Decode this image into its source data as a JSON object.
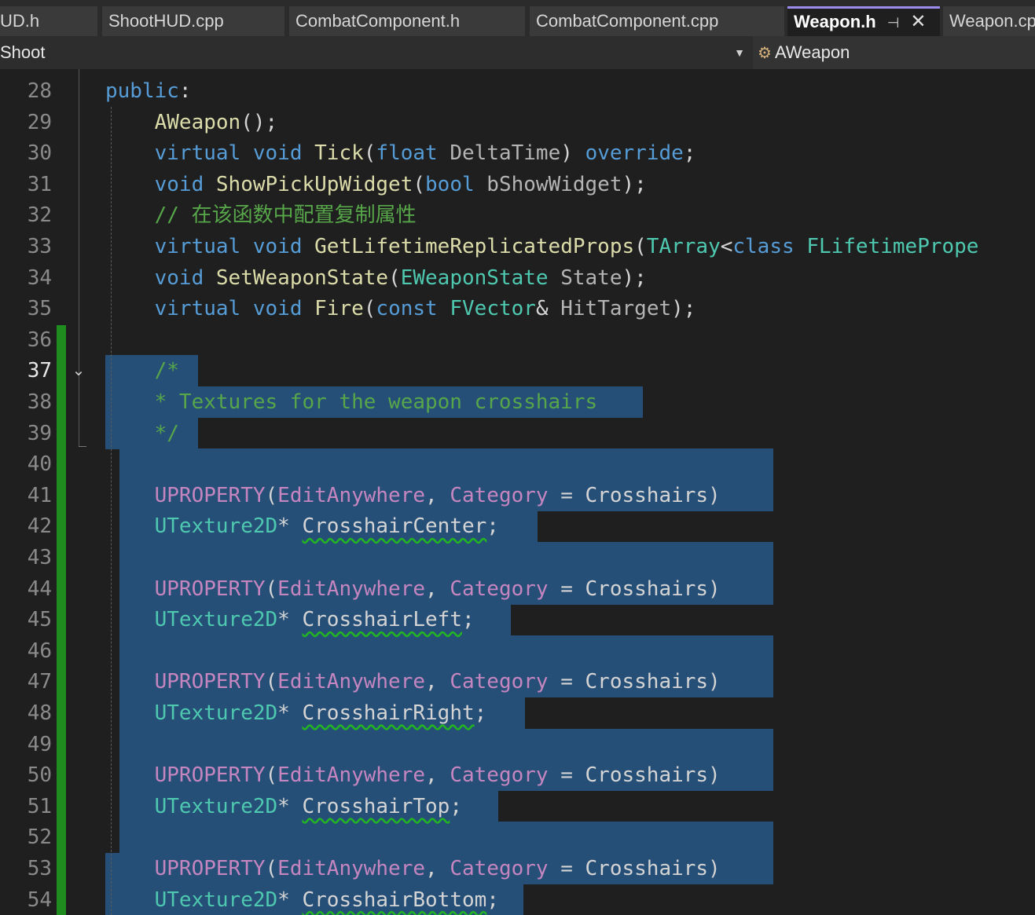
{
  "tabs": [
    {
      "label": "UD.h",
      "active": false
    },
    {
      "label": "ShootHUD.cpp",
      "active": false
    },
    {
      "label": "CombatComponent.h",
      "active": false
    },
    {
      "label": "CombatComponent.cpp",
      "active": false
    },
    {
      "label": "Weapon.h",
      "active": true
    },
    {
      "label": "Weapon.cp",
      "active": false
    }
  ],
  "tab_icons": {
    "pin": "pin-icon",
    "close": "close-icon"
  },
  "navbar": {
    "project": "Shoot",
    "class_scope": "AWeapon",
    "class_icon": "class-icon"
  },
  "editor": {
    "current_line": "37",
    "line_numbers": [
      "28",
      "29",
      "30",
      "31",
      "32",
      "33",
      "34",
      "35",
      "36",
      "37",
      "38",
      "39",
      "40",
      "41",
      "42",
      "43",
      "44",
      "45",
      "46",
      "47",
      "48",
      "49",
      "50",
      "51",
      "52",
      "53",
      "54"
    ],
    "lines": [
      [
        {
          "t": "public",
          "c": "kw"
        },
        {
          "t": ":",
          "c": "pl"
        }
      ],
      [
        {
          "t": "    ",
          "c": "pl"
        },
        {
          "t": "AWeapon",
          "c": "fn"
        },
        {
          "t": "();",
          "c": "pl"
        }
      ],
      [
        {
          "t": "    ",
          "c": "pl"
        },
        {
          "t": "virtual",
          "c": "kw"
        },
        {
          "t": " ",
          "c": "pl"
        },
        {
          "t": "void",
          "c": "kw"
        },
        {
          "t": " ",
          "c": "pl"
        },
        {
          "t": "Tick",
          "c": "fn"
        },
        {
          "t": "(",
          "c": "pl"
        },
        {
          "t": "float",
          "c": "kw"
        },
        {
          "t": " ",
          "c": "pl"
        },
        {
          "t": "DeltaTime",
          "c": "pa"
        },
        {
          "t": ") ",
          "c": "pl"
        },
        {
          "t": "override",
          "c": "kw"
        },
        {
          "t": ";",
          "c": "pl"
        }
      ],
      [
        {
          "t": "    ",
          "c": "pl"
        },
        {
          "t": "void",
          "c": "kw"
        },
        {
          "t": " ",
          "c": "pl"
        },
        {
          "t": "ShowPickUpWidget",
          "c": "fn"
        },
        {
          "t": "(",
          "c": "pl"
        },
        {
          "t": "bool",
          "c": "kw"
        },
        {
          "t": " ",
          "c": "pl"
        },
        {
          "t": "bShowWidget",
          "c": "pa"
        },
        {
          "t": ");",
          "c": "pl"
        }
      ],
      [
        {
          "t": "    ",
          "c": "pl"
        },
        {
          "t": "// 在该函数中配置复制属性",
          "c": "cm"
        }
      ],
      [
        {
          "t": "    ",
          "c": "pl"
        },
        {
          "t": "virtual",
          "c": "kw"
        },
        {
          "t": " ",
          "c": "pl"
        },
        {
          "t": "void",
          "c": "kw"
        },
        {
          "t": " ",
          "c": "pl"
        },
        {
          "t": "GetLifetimeReplicatedProps",
          "c": "fn"
        },
        {
          "t": "(",
          "c": "pl"
        },
        {
          "t": "TArray",
          "c": "ty"
        },
        {
          "t": "<",
          "c": "pl"
        },
        {
          "t": "class",
          "c": "kw"
        },
        {
          "t": " ",
          "c": "pl"
        },
        {
          "t": "FLifetimePrope",
          "c": "ty"
        }
      ],
      [
        {
          "t": "    ",
          "c": "pl"
        },
        {
          "t": "void",
          "c": "kw"
        },
        {
          "t": " ",
          "c": "pl"
        },
        {
          "t": "SetWeaponState",
          "c": "fn"
        },
        {
          "t": "(",
          "c": "pl"
        },
        {
          "t": "EWeaponState",
          "c": "ty"
        },
        {
          "t": " ",
          "c": "pl"
        },
        {
          "t": "State",
          "c": "pa"
        },
        {
          "t": ");",
          "c": "pl"
        }
      ],
      [
        {
          "t": "    ",
          "c": "pl"
        },
        {
          "t": "virtual",
          "c": "kw"
        },
        {
          "t": " ",
          "c": "pl"
        },
        {
          "t": "void",
          "c": "kw"
        },
        {
          "t": " ",
          "c": "pl"
        },
        {
          "t": "Fire",
          "c": "fn"
        },
        {
          "t": "(",
          "c": "pl"
        },
        {
          "t": "const",
          "c": "kw"
        },
        {
          "t": " ",
          "c": "pl"
        },
        {
          "t": "FVector",
          "c": "ty"
        },
        {
          "t": "& ",
          "c": "pl"
        },
        {
          "t": "HitTarget",
          "c": "pa"
        },
        {
          "t": ");",
          "c": "pl"
        }
      ],
      [],
      [
        {
          "t": "    ",
          "c": "pl"
        },
        {
          "t": "/*",
          "c": "cm"
        }
      ],
      [
        {
          "t": "    ",
          "c": "pl"
        },
        {
          "t": "* Textures for the weapon crosshairs",
          "c": "cm"
        }
      ],
      [
        {
          "t": "    ",
          "c": "pl"
        },
        {
          "t": "*/",
          "c": "cm"
        }
      ],
      [],
      [
        {
          "t": "    ",
          "c": "pl"
        },
        {
          "t": "UPROPERTY",
          "c": "mc"
        },
        {
          "t": "(",
          "c": "pl"
        },
        {
          "t": "EditAnywhere",
          "c": "mc"
        },
        {
          "t": ", ",
          "c": "pl"
        },
        {
          "t": "Category",
          "c": "mc"
        },
        {
          "t": " = Crosshairs)",
          "c": "pl"
        }
      ],
      [
        {
          "t": "    ",
          "c": "pl"
        },
        {
          "t": "UTexture2D",
          "c": "ty"
        },
        {
          "t": "* ",
          "c": "pl"
        },
        {
          "t": "CrosshairCenter",
          "c": "wl"
        },
        {
          "t": ";",
          "c": "pl"
        }
      ],
      [],
      [
        {
          "t": "    ",
          "c": "pl"
        },
        {
          "t": "UPROPERTY",
          "c": "mc"
        },
        {
          "t": "(",
          "c": "pl"
        },
        {
          "t": "EditAnywhere",
          "c": "mc"
        },
        {
          "t": ", ",
          "c": "pl"
        },
        {
          "t": "Category",
          "c": "mc"
        },
        {
          "t": " = Crosshairs)",
          "c": "pl"
        }
      ],
      [
        {
          "t": "    ",
          "c": "pl"
        },
        {
          "t": "UTexture2D",
          "c": "ty"
        },
        {
          "t": "* ",
          "c": "pl"
        },
        {
          "t": "CrosshairLeft",
          "c": "wl"
        },
        {
          "t": ";",
          "c": "pl"
        }
      ],
      [],
      [
        {
          "t": "    ",
          "c": "pl"
        },
        {
          "t": "UPROPERTY",
          "c": "mc"
        },
        {
          "t": "(",
          "c": "pl"
        },
        {
          "t": "EditAnywhere",
          "c": "mc"
        },
        {
          "t": ", ",
          "c": "pl"
        },
        {
          "t": "Category",
          "c": "mc"
        },
        {
          "t": " = Crosshairs)",
          "c": "pl"
        }
      ],
      [
        {
          "t": "    ",
          "c": "pl"
        },
        {
          "t": "UTexture2D",
          "c": "ty"
        },
        {
          "t": "* ",
          "c": "pl"
        },
        {
          "t": "CrosshairRight",
          "c": "wl"
        },
        {
          "t": ";",
          "c": "pl"
        }
      ],
      [],
      [
        {
          "t": "    ",
          "c": "pl"
        },
        {
          "t": "UPROPERTY",
          "c": "mc"
        },
        {
          "t": "(",
          "c": "pl"
        },
        {
          "t": "EditAnywhere",
          "c": "mc"
        },
        {
          "t": ", ",
          "c": "pl"
        },
        {
          "t": "Category",
          "c": "mc"
        },
        {
          "t": " = Crosshairs)",
          "c": "pl"
        }
      ],
      [
        {
          "t": "    ",
          "c": "pl"
        },
        {
          "t": "UTexture2D",
          "c": "ty"
        },
        {
          "t": "* ",
          "c": "pl"
        },
        {
          "t": "CrosshairTop",
          "c": "wl"
        },
        {
          "t": ";",
          "c": "pl"
        }
      ],
      [],
      [
        {
          "t": "    ",
          "c": "pl"
        },
        {
          "t": "UPROPERTY",
          "c": "mc"
        },
        {
          "t": "(",
          "c": "pl"
        },
        {
          "t": "EditAnywhere",
          "c": "mc"
        },
        {
          "t": ", ",
          "c": "pl"
        },
        {
          "t": "Category",
          "c": "mc"
        },
        {
          "t": " = Crosshairs)",
          "c": "pl"
        }
      ],
      [
        {
          "t": "    ",
          "c": "pl"
        },
        {
          "t": "UTexture2D",
          "c": "ty"
        },
        {
          "t": "* ",
          "c": "pl"
        },
        {
          "t": "CrosshairBottom",
          "c": "wl"
        },
        {
          "t": ";",
          "c": "pl"
        }
      ]
    ],
    "fold_icon": "chevron-down-icon",
    "colors": {
      "background": "#1f1f1f",
      "selection": "#264f78",
      "change_bar": "#1e8c1e",
      "active_tab_accent": "#9b8cf0"
    }
  }
}
